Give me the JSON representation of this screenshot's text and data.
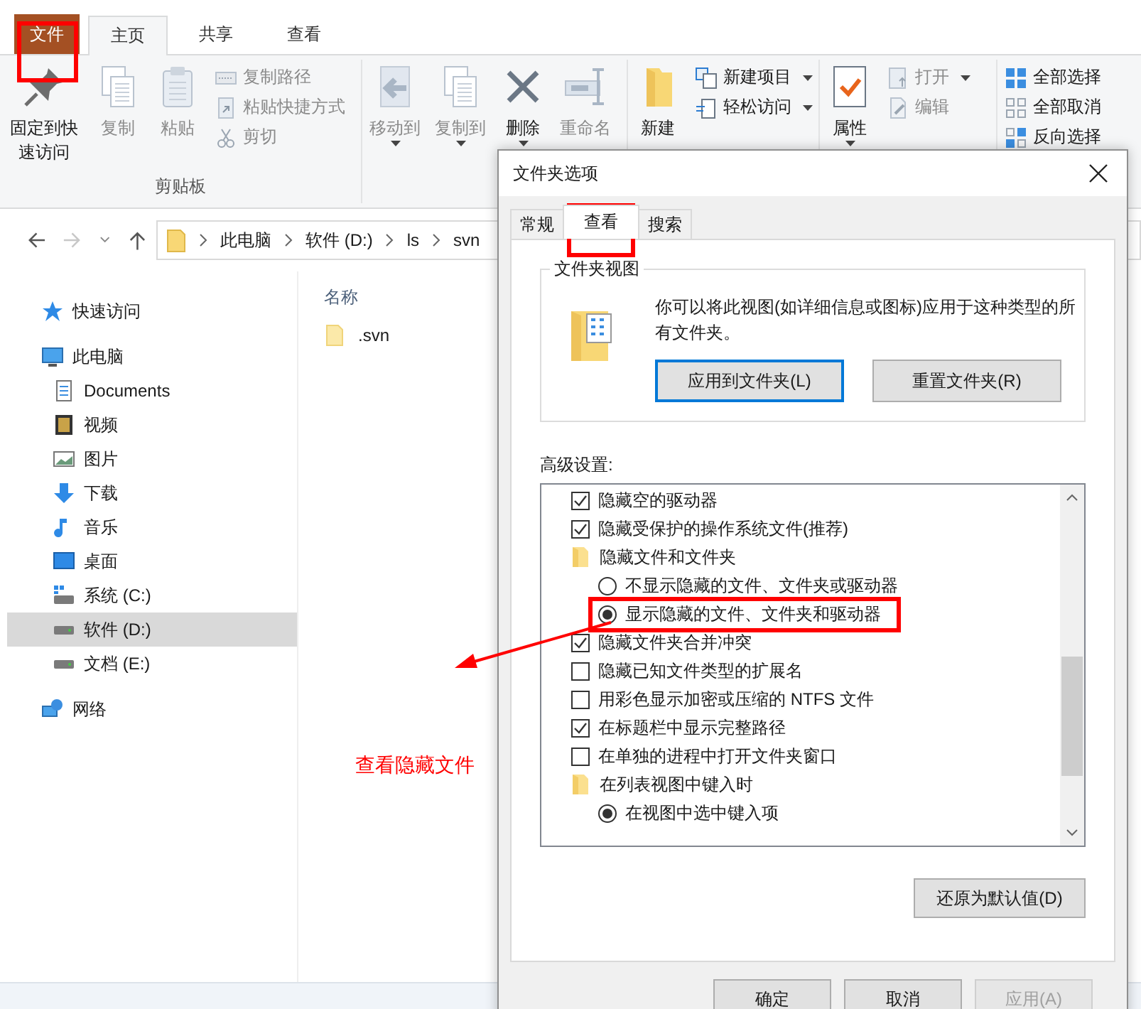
{
  "ribbon": {
    "tabs": [
      {
        "label": "文件",
        "kind": "file",
        "selected": false
      },
      {
        "label": "主页",
        "kind": "tab",
        "selected": true
      },
      {
        "label": "共享",
        "kind": "tab",
        "selected": false
      },
      {
        "label": "查看",
        "kind": "tab",
        "selected": false
      }
    ],
    "groups": [
      {
        "label": "剪贴板",
        "items": [
          {
            "label": "固定到快速访问",
            "kind": "large",
            "disabled": false,
            "dropdown": false
          },
          {
            "label": "复制",
            "kind": "large",
            "disabled": true,
            "dropdown": false
          },
          {
            "label": "粘贴",
            "kind": "large",
            "disabled": true,
            "dropdown": false
          },
          {
            "label": "复制路径",
            "kind": "small",
            "disabled": true,
            "dropdown": false
          },
          {
            "label": "粘贴快捷方式",
            "kind": "small",
            "disabled": true,
            "dropdown": false
          },
          {
            "label": "剪切",
            "kind": "small",
            "disabled": true,
            "dropdown": false
          }
        ]
      },
      {
        "items": [
          {
            "label": "移动到",
            "kind": "large",
            "disabled": true,
            "dropdown": true
          },
          {
            "label": "复制到",
            "kind": "large",
            "disabled": true,
            "dropdown": true
          },
          {
            "label": "删除",
            "kind": "large",
            "disabled": false,
            "dropdown": true
          },
          {
            "label": "重命名",
            "kind": "large",
            "disabled": true,
            "dropdown": false
          }
        ]
      },
      {
        "items": [
          {
            "label": "新建",
            "kind": "large",
            "disabled": false,
            "dropdown": false
          },
          {
            "label": "新建项目",
            "kind": "small",
            "disabled": false,
            "dropdown": true
          },
          {
            "label": "轻松访问",
            "kind": "small",
            "disabled": false,
            "dropdown": true
          }
        ]
      },
      {
        "items": [
          {
            "label": "属性",
            "kind": "large",
            "disabled": false,
            "dropdown": true
          },
          {
            "label": "打开",
            "kind": "small",
            "disabled": true,
            "dropdown": true
          },
          {
            "label": "编辑",
            "kind": "small",
            "disabled": true,
            "dropdown": false
          }
        ]
      },
      {
        "items": [
          {
            "label": "全部选择",
            "kind": "small",
            "disabled": false,
            "dropdown": false
          },
          {
            "label": "全部取消",
            "kind": "small",
            "disabled": false,
            "dropdown": false
          },
          {
            "label": "反向选择",
            "kind": "small",
            "disabled": false,
            "dropdown": false
          }
        ]
      }
    ]
  },
  "address": {
    "path": [
      "此电脑",
      "软件 (D:)",
      "ls",
      "svn"
    ]
  },
  "sidebar": {
    "items": [
      {
        "label": "快速访问",
        "selected": false
      },
      {
        "label": "此电脑",
        "selected": false,
        "children": [
          {
            "label": "Documents",
            "selected": false
          },
          {
            "label": "视频",
            "selected": false
          },
          {
            "label": "图片",
            "selected": false
          },
          {
            "label": "下载",
            "selected": false
          },
          {
            "label": "音乐",
            "selected": false
          },
          {
            "label": "桌面",
            "selected": false
          },
          {
            "label": "系统 (C:)",
            "selected": false
          },
          {
            "label": "软件 (D:)",
            "selected": true
          },
          {
            "label": "文档 (E:)",
            "selected": false
          }
        ]
      },
      {
        "label": "网络",
        "selected": false
      }
    ]
  },
  "files": {
    "columns": [
      "名称"
    ],
    "rows": [
      ".svn"
    ]
  },
  "dialog": {
    "title": "文件夹选项",
    "tabs": [
      {
        "label": "常规",
        "selected": false
      },
      {
        "label": "查看",
        "selected": true
      },
      {
        "label": "搜索",
        "selected": false
      }
    ],
    "folder_views": {
      "legend": "文件夹视图",
      "text": "你可以将此视图(如详细信息或图标)应用于这种类型的所有文件夹。",
      "buttons": [
        {
          "label": "应用到文件夹(L)",
          "focused": true
        },
        {
          "label": "重置文件夹(R)",
          "focused": false
        }
      ]
    },
    "advanced_label": "高级设置:",
    "settings": [
      {
        "kind": "checkbox",
        "label": "隐藏空的驱动器",
        "checked": true
      },
      {
        "kind": "checkbox",
        "label": "隐藏受保护的操作系统文件(推荐)",
        "checked": true
      },
      {
        "kind": "folder",
        "label": "隐藏文件和文件夹",
        "children": [
          {
            "kind": "radio",
            "label": "不显示隐藏的文件、文件夹或驱动器",
            "selected": false
          },
          {
            "kind": "radio",
            "label": "显示隐藏的文件、文件夹和驱动器",
            "selected": true
          }
        ]
      },
      {
        "kind": "checkbox",
        "label": "隐藏文件夹合并冲突",
        "checked": true
      },
      {
        "kind": "checkbox",
        "label": "隐藏已知文件类型的扩展名",
        "checked": false
      },
      {
        "kind": "checkbox",
        "label": "用彩色显示加密或压缩的 NTFS 文件",
        "checked": false
      },
      {
        "kind": "checkbox",
        "label": "在标题栏中显示完整路径",
        "checked": true
      },
      {
        "kind": "checkbox",
        "label": "在单独的进程中打开文件夹窗口",
        "checked": false
      },
      {
        "kind": "folder",
        "label": "在列表视图中键入时",
        "children": [
          {
            "kind": "radio",
            "label": "在视图中选中键入项",
            "selected": true
          }
        ]
      }
    ],
    "restore_button": "还原为默认值(D)",
    "buttons": [
      {
        "label": "确定",
        "disabled": false
      },
      {
        "label": "取消",
        "disabled": false
      },
      {
        "label": "应用(A)",
        "disabled": true
      }
    ]
  },
  "annotation": {
    "note": "查看隐藏文件"
  }
}
